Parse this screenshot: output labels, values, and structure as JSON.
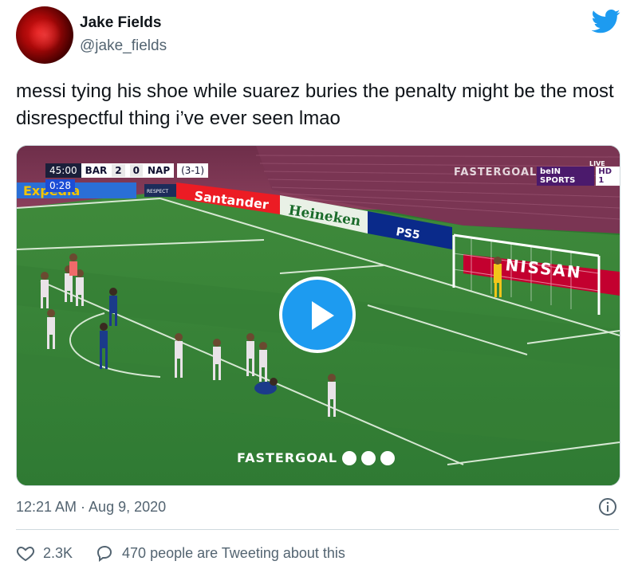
{
  "author": {
    "name": "Jake Fields",
    "handle": "@jake_fields"
  },
  "tweet": {
    "text": "messi tying his shoe while suarez buries the penalty might be the most disrespectful thing i’ve ever seen lmao",
    "timestamp": "12:21 AM · Aug 9, 2020"
  },
  "video": {
    "clock": "45:00",
    "home_team": "BAR",
    "home_score": "2",
    "away_score": "0",
    "away_team": "NAP",
    "aggregate": "(3-1)",
    "video_time": "0:28",
    "watermark": "FASTERGOAL",
    "broadcaster": "beIN SPORTS",
    "broadcaster_hd": "HD 1",
    "live_label": "LIVE",
    "ad_boards": [
      "Expedia",
      "RESPECT",
      "Santander",
      "Heineken",
      "PS5",
      "NISSAN"
    ]
  },
  "stats": {
    "likes": "2.3K",
    "tweeting": "470 people are Tweeting about this"
  },
  "colors": {
    "brand": "#1d9bf0",
    "text": "#0f1419",
    "muted": "#536471",
    "border": "#cfd9de"
  },
  "icons": [
    "twitter-bird-icon",
    "play-icon",
    "info-icon",
    "heart-icon",
    "speech-bubble-icon"
  ]
}
